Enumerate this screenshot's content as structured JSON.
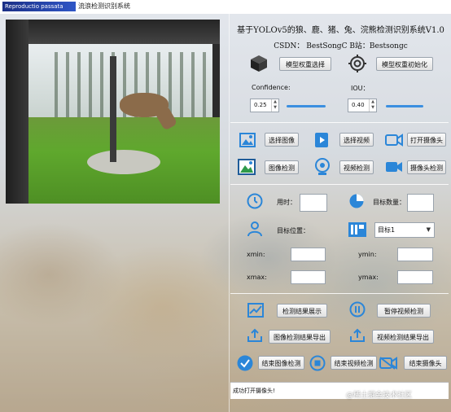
{
  "window": {
    "logo_text": "Reproductio passata",
    "title": "流浪检测识别系统"
  },
  "header": {
    "title": "基于YOLOv5的狼、鹿、猪、兔、浣熊检测识别系统V1.0",
    "subtitle": "CSDN： BestSongC   B站：Bestsongc"
  },
  "model": {
    "select_label": "模型权重选择",
    "init_label": "模型权重初始化",
    "confidence_label": "Confidence:",
    "confidence_value": "0.25",
    "confidence_level": 0.25,
    "iou_label": "IOU：",
    "iou_value": "0.40",
    "iou_level": 0.4
  },
  "actions": {
    "select_image": "选择图像",
    "select_video": "选择视频",
    "open_camera": "打开摄像头",
    "image_detect": "图像检测",
    "video_detect": "视频检测",
    "camera_detect": "摄像头检测"
  },
  "stats": {
    "time_label": "用时：",
    "target_count_label": "目标数量：",
    "target_pos_label": "目标位置：",
    "target_select": "目标1",
    "xmin_label": "xmin:",
    "ymin_label": "ymin:",
    "xmax_label": "xmax:",
    "ymax_label": "ymax:"
  },
  "results": {
    "show_results": "检测结果展示",
    "pause_video": "暂停视频检测",
    "export_image": "图像检测结果导出",
    "export_video": "视频检测结果导出",
    "end_image": "结束图像检测",
    "end_video": "结束视频检测",
    "end_camera": "结束摄像头"
  },
  "status": {
    "message": "成功打开摄像头!"
  },
  "watermark": "@稀土掘金技术社区",
  "colors": {
    "accent": "#2b86d8",
    "slider": "#3b8fe0"
  }
}
